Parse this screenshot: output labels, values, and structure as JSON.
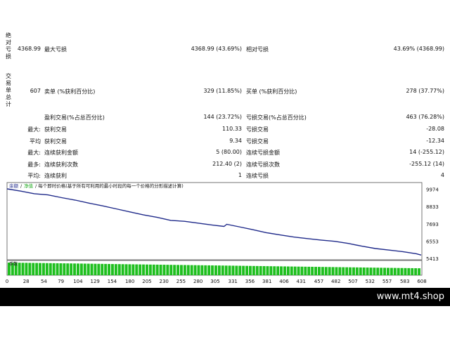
{
  "side_labels": {
    "drawdown": "绝\n对\n亏\n损",
    "trades": "交\n易\n单\n总\n计"
  },
  "stats": {
    "abs_dd_value": "4368.99",
    "max_dd_label": "最大亏损",
    "max_dd_value": "4368.99 (43.69%)",
    "rel_dd_label": "相对亏损",
    "rel_dd_value": "43.69% (4368.99)",
    "total_trades": "607",
    "short_label": "卖单 (%获利百分比)",
    "short_value": "329 (11.85%)",
    "long_label": "买单 (%获利百分比)",
    "long_value": "278 (37.77%)",
    "profit_trades_label": "盈利交易(%占总百分比)",
    "profit_trades_value": "144 (23.72%)",
    "loss_trades_label": "亏损交易(%占总百分比)",
    "loss_trades_value": "463 (76.28%)",
    "max_prefix": "最大:",
    "largest_profit_label": "获利交易",
    "largest_profit_value": "110.33",
    "largest_loss_label": "亏损交易",
    "largest_loss_value": "-28.08",
    "avg_prefix": "平均",
    "avg_profit_label": "获利交易",
    "avg_profit_value": "9.34",
    "avg_loss_label": "亏损交易",
    "avg_loss_value": "-12.34",
    "max2_prefix": "最大:",
    "cons_wins_money_label": "连续获利金额",
    "cons_wins_money_value": "5 (80.00)",
    "cons_loss_money_label": "连续亏损金额",
    "cons_loss_money_value": "14 (-255.12)",
    "most_prefix": "最多:",
    "cons_profit_count_label": "连续获利次数",
    "cons_profit_count_value": "212.40 (2)",
    "cons_loss_count_label": "连续亏损次数",
    "cons_loss_count_value": "-255.12 (14)",
    "avg2_prefix": "平均:",
    "avg_cons_wins_label": "连续获利",
    "avg_cons_wins_value": "1",
    "avg_cons_loss_label": "连续亏损",
    "avg_cons_loss_value": "4"
  },
  "chart_data": {
    "type": "line",
    "title": "余额 / 净值 / 每个即时价格(基于所有可利用的最小时段的每一个价格的分形描述计算)",
    "legend": [
      "余额",
      "净值"
    ],
    "volume_label": "手数",
    "colors": {
      "balance": "#1f2a8a",
      "volume": "#1fbf1f",
      "legend_equity": "#22aa22",
      "legend_balance": "#1f2a8a"
    },
    "y_ticks": [
      9974,
      8833,
      7693,
      6553,
      5413
    ],
    "ylim": [
      5413,
      10000
    ],
    "x_ticks": [
      0,
      28,
      54,
      79,
      104,
      129,
      154,
      180,
      205,
      230,
      255,
      280,
      305,
      331,
      356,
      381,
      406,
      431,
      457,
      482,
      507,
      532,
      557,
      583,
      608
    ],
    "xlim": [
      0,
      608
    ],
    "x": [
      0,
      20,
      40,
      60,
      80,
      100,
      120,
      140,
      160,
      180,
      200,
      220,
      240,
      260,
      280,
      300,
      318,
      322,
      340,
      360,
      380,
      400,
      420,
      440,
      460,
      480,
      500,
      520,
      540,
      560,
      580,
      600,
      607
    ],
    "y": [
      10000,
      9850,
      9680,
      9600,
      9420,
      9260,
      9060,
      8880,
      8680,
      8480,
      8280,
      8120,
      7920,
      7860,
      7740,
      7620,
      7520,
      7660,
      7500,
      7310,
      7110,
      6960,
      6820,
      6720,
      6620,
      6540,
      6400,
      6220,
      6060,
      5960,
      5860,
      5720,
      5631
    ],
    "volume_start": 1.0,
    "volume_end": 0.55
  },
  "footer": {
    "site": "www.mt4.shop"
  }
}
